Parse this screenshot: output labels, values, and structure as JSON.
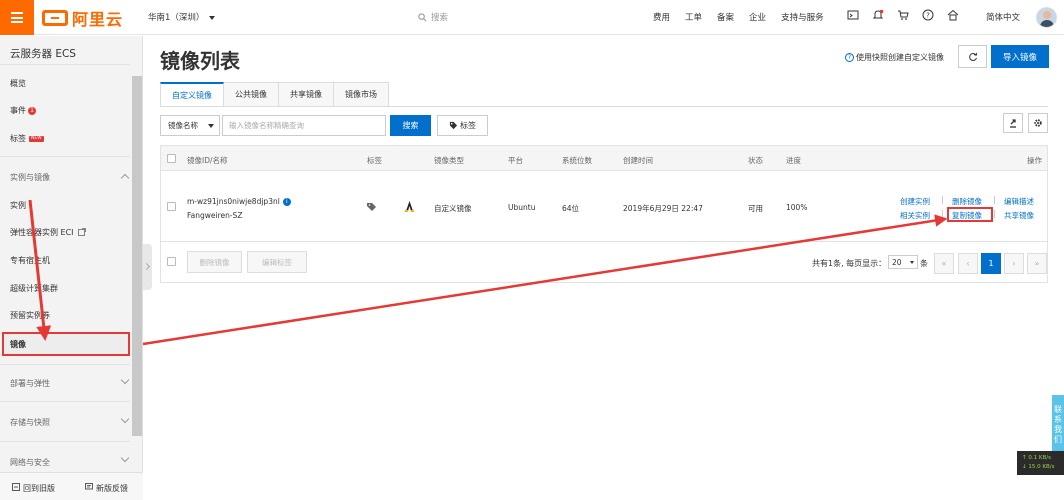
{
  "topbar": {
    "brand": "阿里云",
    "region": "华南1（深圳）",
    "search_placeholder": "搜索",
    "nav": [
      "费用",
      "工单",
      "备案",
      "企业",
      "支持与服务"
    ],
    "language": "简体中文"
  },
  "sidebar": {
    "title": "云服务器 ECS",
    "overview": "概览",
    "events": "事件",
    "events_badge": "1",
    "tags": "标签",
    "tags_badge": "NEW",
    "groups": {
      "instances_images": "实例与镜像",
      "deploy_elastic": "部署与弹性",
      "storage_snapshots": "存储与快照",
      "network_security": "网络与安全"
    },
    "items": {
      "instances": "实例",
      "eci": "弹性容器实例 ECI",
      "dedicated_host": "专有宿主机",
      "super_cluster": "超级计算集群",
      "reserved": "预留实例券",
      "images": "镜像"
    },
    "footer_old": "回到旧版",
    "footer_feedback": "新版反馈"
  },
  "main": {
    "title": "镜像列表",
    "help_link": "使用快照创建自定义镜像",
    "import_button": "导入镜像",
    "tabs": [
      "自定义镜像",
      "公共镜像",
      "共享镜像",
      "镜像市场"
    ],
    "filter": {
      "field": "镜像名称",
      "placeholder": "输入镜像名称精确查询",
      "search_button": "搜索",
      "tags_button": "标签"
    },
    "table": {
      "headers": {
        "id_name": "镜像ID/名称",
        "tag": "标签",
        "type": "镜像类型",
        "platform": "平台",
        "bits": "系统位数",
        "created": "创建时间",
        "status": "状态",
        "progress": "进度",
        "actions": "操作"
      },
      "rows": [
        {
          "id": "m-wz91jns0niwje8djp3nl",
          "name": "Fangweiren-SZ",
          "type": "自定义镜像",
          "platform": "Ubuntu",
          "bits": "64位",
          "created": "2019年6月29日 22:47",
          "status": "可用",
          "progress": "100%",
          "actions": [
            "创建实例",
            "删除镜像",
            "编辑描述",
            "相关实例",
            "复制镜像",
            "共享镜像"
          ]
        }
      ],
      "bulk_delete": "删除镜像",
      "bulk_edit_tags": "编辑标签"
    },
    "pagination": {
      "summary": "共有1条, 每页显示：",
      "page_size": "20",
      "suffix": "条",
      "current_page": "1"
    }
  },
  "widgets": {
    "contact": "联系我们",
    "net_up": "0.1 KB/s",
    "net_down": "15.0 KB/s"
  },
  "colors": {
    "brand_orange": "#ff6a00",
    "primary_blue": "#0070cc",
    "annotation_red": "#e53935"
  }
}
